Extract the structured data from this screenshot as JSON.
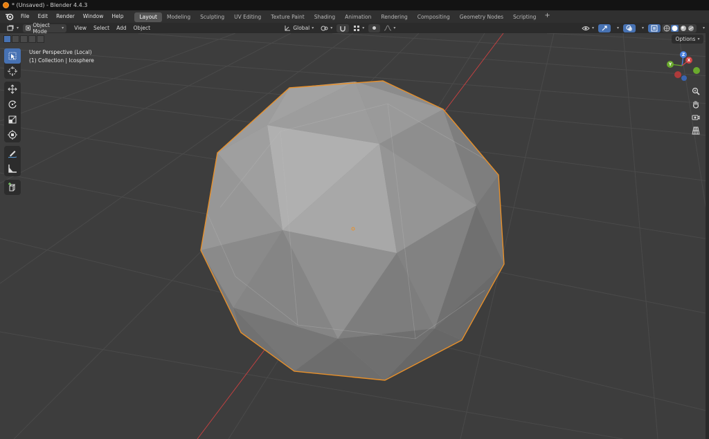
{
  "window": {
    "title": "* (Unsaved) - Blender 4.4.3"
  },
  "menu": [
    "File",
    "Edit",
    "Render",
    "Window",
    "Help"
  ],
  "workspace_tabs": [
    {
      "label": "Layout",
      "active": true
    },
    {
      "label": "Modeling"
    },
    {
      "label": "Sculpting"
    },
    {
      "label": "UV Editing"
    },
    {
      "label": "Texture Paint"
    },
    {
      "label": "Shading"
    },
    {
      "label": "Animation"
    },
    {
      "label": "Rendering"
    },
    {
      "label": "Compositing"
    },
    {
      "label": "Geometry Nodes"
    },
    {
      "label": "Scripting"
    }
  ],
  "viewport_header": {
    "mode": "Object Mode",
    "menus": [
      "View",
      "Select",
      "Add",
      "Object"
    ],
    "transform_orientation": "Global"
  },
  "viewport": {
    "perspective_label": "User Perspective (Local)",
    "collection_label": "(1) Collection | Icosphere",
    "options_label": "Options"
  },
  "gizmo": {
    "z": "Z",
    "x": "X",
    "y": "Y"
  },
  "colors": {
    "selection_outline": "#e8902a",
    "x_axis": "#d04545",
    "active_tool": "#4772b3",
    "viewport_bg": "#3d3d3d"
  },
  "icons": {
    "toolbar": [
      "select-box-icon",
      "cursor-icon",
      "move-icon",
      "rotate-icon",
      "scale-icon",
      "transform-icon",
      "annotate-icon",
      "measure-icon",
      "add-cube-icon"
    ],
    "nav": [
      "zoom-icon",
      "hand-icon",
      "camera-icon",
      "grid-icon"
    ]
  }
}
